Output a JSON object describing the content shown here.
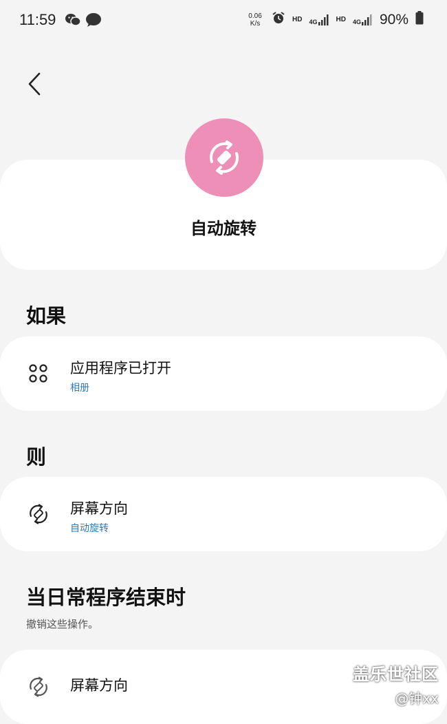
{
  "status_bar": {
    "time": "11:59",
    "speed_value": "0.06",
    "speed_unit": "K/s",
    "hd1": "HD",
    "net1": "4G",
    "hd2": "HD",
    "net2": "4G",
    "battery": "90%"
  },
  "hero": {
    "title": "自动旋转"
  },
  "sections": {
    "if_title": "如果",
    "then_title": "则",
    "end_title": "当日常程序结束时",
    "end_subtitle": "撤销这些操作。"
  },
  "rows": {
    "if_row": {
      "title": "应用程序已打开",
      "subtitle": "相册"
    },
    "then_row": {
      "title": "屏幕方向",
      "subtitle": "自动旋转"
    },
    "end_row": {
      "title": "屏幕方向"
    }
  },
  "watermark": {
    "brand": "盖乐世社区",
    "user": "@钟xx"
  },
  "colors": {
    "accent_pink": "#ee8fb8",
    "link_blue": "#2f7ab4",
    "background": "#f4f4f4",
    "card": "#ffffff"
  },
  "icons": {
    "back": "chevron-left-icon",
    "hero": "auto-rotate-icon",
    "if_row": "apps-grid-icon",
    "then_row": "rotate-icon",
    "end_row": "rotate-icon"
  }
}
